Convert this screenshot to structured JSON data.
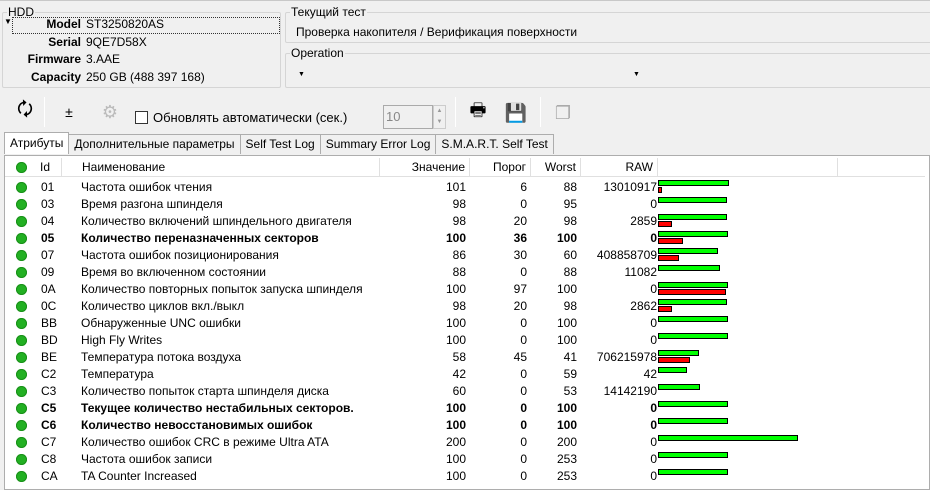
{
  "hdd": {
    "title": "HDD",
    "model_label": "Model",
    "model": "ST3250820AS",
    "serial_label": "Serial",
    "serial": "9QE7D58X",
    "firmware_label": "Firmware",
    "firmware": "3.AAE",
    "capacity_label": "Capacity",
    "capacity": "250 GB (488 397 168)"
  },
  "current_test": {
    "title": "Текущий тест",
    "value": "Проверка накопителя / Верификация поверхности"
  },
  "operation": {
    "title": "Operation",
    "value": ""
  },
  "toolbar": {
    "auto_refresh_label": "Обновлять автоматически (сек.)",
    "interval": "10"
  },
  "tabs": [
    "Атрибуты",
    "Дополнительные параметры",
    "Self Test Log",
    "Summary Error Log",
    "S.M.A.R.T. Self Test"
  ],
  "columns": {
    "id": "Id",
    "name": "Наименование",
    "value": "Значение",
    "threshold": "Порог",
    "worst": "Worst",
    "raw": "RAW"
  },
  "colors": {
    "ok": "#22b022",
    "value_bar": "#00ff00",
    "threshold_bar": "#ff0000"
  },
  "rows": [
    {
      "id": "01",
      "name": "Частота ошибок чтения",
      "value": 101,
      "threshold": 6,
      "worst": 88,
      "raw": "13010917",
      "bold": false
    },
    {
      "id": "03",
      "name": "Время разгона шпинделя",
      "value": 98,
      "threshold": 0,
      "worst": 95,
      "raw": "0",
      "bold": false
    },
    {
      "id": "04",
      "name": "Количество включений шпиндельного двигателя",
      "value": 98,
      "threshold": 20,
      "worst": 98,
      "raw": "2859",
      "bold": false
    },
    {
      "id": "05",
      "name": "Количество переназначенных секторов",
      "value": 100,
      "threshold": 36,
      "worst": 100,
      "raw": "0",
      "bold": true
    },
    {
      "id": "07",
      "name": "Частота ошибок позиционирования",
      "value": 86,
      "threshold": 30,
      "worst": 60,
      "raw": "408858709",
      "bold": false
    },
    {
      "id": "09",
      "name": "Время во включенном состоянии",
      "value": 88,
      "threshold": 0,
      "worst": 88,
      "raw": "11082",
      "bold": false
    },
    {
      "id": "0A",
      "name": "Количество повторных попыток запуска шпинделя",
      "value": 100,
      "threshold": 97,
      "worst": 100,
      "raw": "0",
      "bold": false
    },
    {
      "id": "0C",
      "name": "Количество циклов вкл./выкл",
      "value": 98,
      "threshold": 20,
      "worst": 98,
      "raw": "2862",
      "bold": false
    },
    {
      "id": "BB",
      "name": "Обнаруженные UNC ошибки",
      "value": 100,
      "threshold": 0,
      "worst": 100,
      "raw": "0",
      "bold": false
    },
    {
      "id": "BD",
      "name": "High Fly Writes",
      "value": 100,
      "threshold": 0,
      "worst": 100,
      "raw": "0",
      "bold": false
    },
    {
      "id": "BE",
      "name": "Температура потока воздуха",
      "value": 58,
      "threshold": 45,
      "worst": 41,
      "raw": "706215978",
      "bold": false
    },
    {
      "id": "C2",
      "name": "Температура",
      "value": 42,
      "threshold": 0,
      "worst": 59,
      "raw": "42",
      "bold": false
    },
    {
      "id": "C3",
      "name": "Количество попыток старта шпинделя диска",
      "value": 60,
      "threshold": 0,
      "worst": 53,
      "raw": "14142190",
      "bold": false
    },
    {
      "id": "C5",
      "name": "Текущее количество нестабильных секторов.",
      "value": 100,
      "threshold": 0,
      "worst": 100,
      "raw": "0",
      "bold": true
    },
    {
      "id": "C6",
      "name": "Количество невосстановимых ошибок",
      "value": 100,
      "threshold": 0,
      "worst": 100,
      "raw": "0",
      "bold": true
    },
    {
      "id": "C7",
      "name": "Количество ошибок CRC в режиме Ultra ATA",
      "value": 200,
      "threshold": 0,
      "worst": 200,
      "raw": "0",
      "bold": false
    },
    {
      "id": "C8",
      "name": "Частота ошибок записи",
      "value": 100,
      "threshold": 0,
      "worst": 253,
      "raw": "0",
      "bold": false
    },
    {
      "id": "CA",
      "name": "TA Counter Increased",
      "value": 100,
      "threshold": 0,
      "worst": 253,
      "raw": "0",
      "bold": false
    }
  ]
}
